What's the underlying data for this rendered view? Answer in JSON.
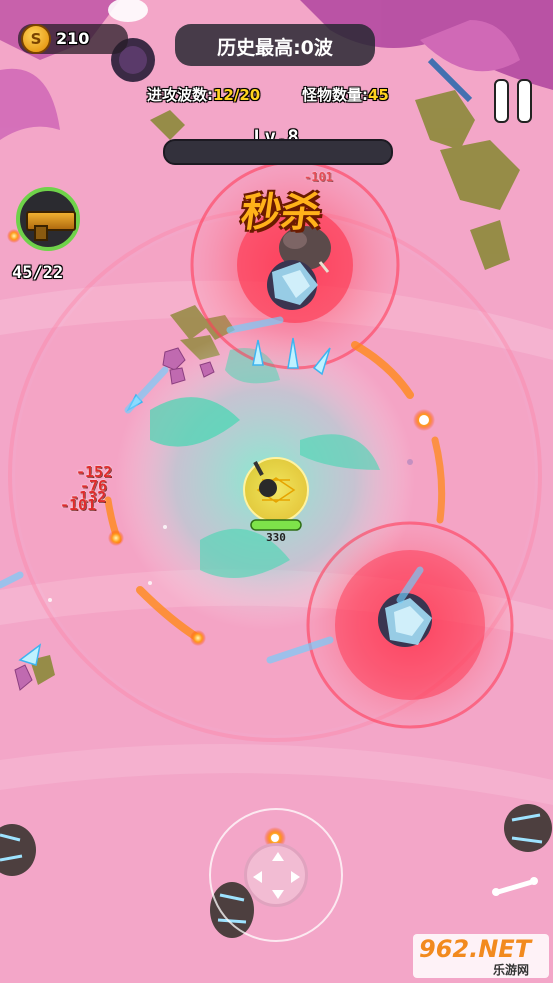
{
  "hud": {
    "coin_icon_glyph": "S",
    "coins": "210",
    "best_record": "历史最高:0波",
    "wave_label": "进攻波数:",
    "wave_value": "12/20",
    "monster_label": "怪物数量:",
    "monster_value": "45",
    "level": "Lv.8",
    "ammo": "45/22",
    "kill_banner": "秒杀"
  },
  "player": {
    "hp": "330"
  },
  "damage_numbers": [
    "-152",
    "-76",
    "-132",
    "-101",
    "-101"
  ],
  "watermark": {
    "brand": "962.NET",
    "sub": "乐游网"
  },
  "colors": {
    "ground": "#f3a6c8",
    "accent_yellow": "#ffd21f",
    "danger_red": "#ff3b4e",
    "player_hp": "#7ee34a",
    "ice_blue": "#8fe1ff"
  },
  "icons": [
    "coin-icon",
    "weapon-icon",
    "pause-icon",
    "joystick-icon",
    "enemy-boar-icon",
    "fireball-icon",
    "ice-shard-icon",
    "bone-icon"
  ]
}
